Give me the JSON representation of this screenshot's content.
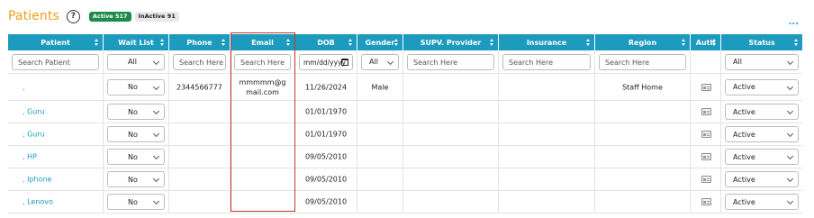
{
  "header": {
    "title": "Patients",
    "help_icon": "?",
    "active_badge": "Active 517",
    "inactive_badge": "InActive 91",
    "more_icon": "..."
  },
  "columns": [
    {
      "label": "Patient"
    },
    {
      "label": "Wait List"
    },
    {
      "label": "Phone"
    },
    {
      "label": "Email"
    },
    {
      "label": "DOB"
    },
    {
      "label": "Gender"
    },
    {
      "label": "SUPV. Provider"
    },
    {
      "label": "Insurance"
    },
    {
      "label": "Region"
    },
    {
      "label": "Auth"
    },
    {
      "label": "Status"
    }
  ],
  "filters": {
    "patient_placeholder": "Search Patient",
    "waitlist_value": "All",
    "phone_placeholder": "Search Here",
    "email_placeholder": "Search Here",
    "dob_placeholder": "mm/dd/yyyy",
    "gender_value": "All",
    "supv_placeholder": "Search Here",
    "insurance_placeholder": "Search Here",
    "region_placeholder": "Search Here",
    "status_value": "All"
  },
  "rows": [
    {
      "patient": ",",
      "waitlist": "No",
      "phone": "2344566777",
      "email": "mmmmm@gmail.com",
      "dob": "11/26/2024",
      "gender": "Male",
      "region": "Staff Home",
      "status": "Active"
    },
    {
      "patient": ", Guru",
      "waitlist": "No",
      "phone": "",
      "email": "",
      "dob": "01/01/1970",
      "gender": "",
      "region": "",
      "status": "Active"
    },
    {
      "patient": ", Guru",
      "waitlist": "No",
      "phone": "",
      "email": "",
      "dob": "01/01/1970",
      "gender": "",
      "region": "",
      "status": "Active"
    },
    {
      "patient": ", HP",
      "waitlist": "No",
      "phone": "",
      "email": "",
      "dob": "09/05/2010",
      "gender": "",
      "region": "",
      "status": "Active"
    },
    {
      "patient": ", Iphone",
      "waitlist": "No",
      "phone": "",
      "email": "",
      "dob": "09/05/2010",
      "gender": "",
      "region": "",
      "status": "Active"
    },
    {
      "patient": ", Lenovo",
      "waitlist": "No",
      "phone": "",
      "email": "",
      "dob": "09/05/2010",
      "gender": "",
      "region": "",
      "status": "Active"
    }
  ],
  "colors": {
    "header_bg": "#1d9bbf",
    "title": "#f0a01e",
    "link": "#1d9bbf",
    "active_badge": "#1f8a4c",
    "highlight_border": "#c0392b"
  }
}
